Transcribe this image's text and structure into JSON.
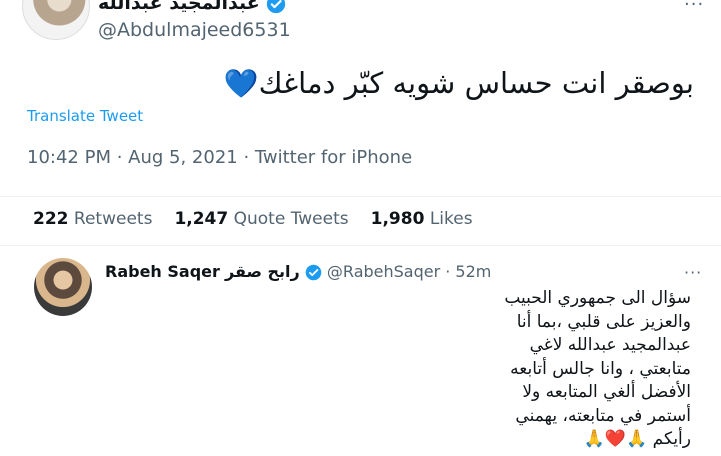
{
  "author": {
    "display_name": "عبدالمجيد عبدالله",
    "handle": "@Abdulmajeed6531",
    "more_label": "···"
  },
  "tweet": {
    "text": "بوصقر انت حساس شويه كبّر دماغك",
    "emoji": "💙",
    "translate_label": "Translate Tweet",
    "timestamp": "10:42 PM · Aug 5, 2021 · Twitter for iPhone"
  },
  "stats": {
    "retweets_count": "222",
    "retweets_label": "Retweets",
    "quote_count": "1,247",
    "quote_label": "Quote Tweets",
    "likes_count": "1,980",
    "likes_label": "Likes"
  },
  "reply": {
    "name_latin": "Rabeh Saqer",
    "name_arabic": "رابح صقر",
    "handle_time": "@RabehSaqer · 52m",
    "more_label": "···",
    "lines": [
      "سؤال الى جمهوري الحبيب",
      "والعزيز على قلبي ،بما أنا",
      "عبدالمجيد عبدالله لاغي",
      "متابعتي ، وانا جالس أتابعه",
      "الأفضل ألغي المتابعه ولا",
      "أستمر في متابعته، يهمني",
      "رأيكم"
    ],
    "end_emojis": "🙏❤️🙏"
  },
  "colors": {
    "accent": "#1d9bf0",
    "muted": "#536471",
    "verified": "#1d9bf0"
  }
}
